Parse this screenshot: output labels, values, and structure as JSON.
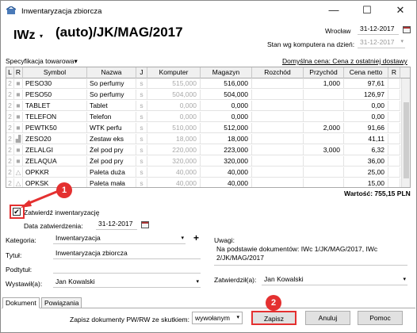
{
  "window": {
    "title": "Inwentaryzacja zbiorcza",
    "min_glyph": "—",
    "max_glyph": "☐",
    "close_glyph": "✕"
  },
  "header": {
    "doc_type": "IWz",
    "doc_caret": "▾",
    "doc_number": "(auto)/JK/MAG/2017",
    "city": "Wrocław",
    "date": "31-12-2017",
    "stock_label": "Stan wg komputera na dzień:",
    "stock_date": "31-12-2017"
  },
  "spec": {
    "label": "Specyfikacja towarowa",
    "caret": "▾",
    "price_label": "Domyślna cena: Cena z ostatniej dostawy"
  },
  "table": {
    "columns": [
      "L",
      "R",
      "Symbol",
      "Nazwa",
      "J",
      "Komputer",
      "Magazyn",
      "Rozchód",
      "Przychód",
      "Cena netto",
      "R"
    ],
    "rows": [
      {
        "l": "2",
        "r": "■",
        "symbol": "PESO30",
        "nazwa": "So perfumy",
        "j": "s",
        "komputer": "515,000",
        "magazyn": "516,000",
        "rozchod": "",
        "przychod": "1,000",
        "cena": "97,61"
      },
      {
        "l": "2",
        "r": "■",
        "symbol": "PESO50",
        "nazwa": "So perfumy",
        "j": "s",
        "komputer": "504,000",
        "magazyn": "504,000",
        "rozchod": "",
        "przychod": "",
        "cena": "126,97"
      },
      {
        "l": "2",
        "r": "■",
        "symbol": "TABLET",
        "nazwa": "Tablet",
        "j": "s",
        "komputer": "0,000",
        "magazyn": "0,000",
        "rozchod": "",
        "przychod": "",
        "cena": "0,00"
      },
      {
        "l": "2",
        "r": "■",
        "symbol": "TELEFON",
        "nazwa": "Telefon",
        "j": "s",
        "komputer": "0,000",
        "magazyn": "0,000",
        "rozchod": "",
        "przychod": "",
        "cena": "0,00"
      },
      {
        "l": "2",
        "r": "■",
        "symbol": "PEWTK50",
        "nazwa": "WTK perfu",
        "j": "s",
        "komputer": "510,000",
        "magazyn": "512,000",
        "rozchod": "",
        "przychod": "2,000",
        "cena": "91,66"
      },
      {
        "l": "2",
        "r": "▟",
        "symbol": "ZESO20",
        "nazwa": "Zestaw eks",
        "j": "s",
        "komputer": "18,000",
        "magazyn": "18,000",
        "rozchod": "",
        "przychod": "",
        "cena": "41,11"
      },
      {
        "l": "2",
        "r": "■",
        "symbol": "ZELALGI",
        "nazwa": "Żel pod pry",
        "j": "s",
        "komputer": "220,000",
        "magazyn": "223,000",
        "rozchod": "",
        "przychod": "3,000",
        "cena": "6,32"
      },
      {
        "l": "2",
        "r": "■",
        "symbol": "ZELAQUA",
        "nazwa": "Żel pod pry",
        "j": "s",
        "komputer": "320,000",
        "magazyn": "320,000",
        "rozchod": "",
        "przychod": "",
        "cena": "36,00"
      },
      {
        "l": "2",
        "r": "△",
        "symbol": "OPKKR",
        "nazwa": "Paleta duża",
        "j": "s",
        "komputer": "40,000",
        "magazyn": "40,000",
        "rozchod": "",
        "przychod": "",
        "cena": "25,00"
      },
      {
        "l": "2",
        "r": "△",
        "symbol": "OPKSK",
        "nazwa": "Paleta mała",
        "j": "s",
        "komputer": "40,000",
        "magazyn": "40,000",
        "rozchod": "",
        "przychod": "",
        "cena": "15,00"
      }
    ],
    "total": "Wartość: 755,15 PLN"
  },
  "approve": {
    "checkbox_label": "Zatwierdź inwentaryzację",
    "checked_glyph": "✔",
    "date_label": "Data zatwierdzenia:",
    "date_value": "31-12-2017"
  },
  "form": {
    "kategoria_label": "Kategoria:",
    "kategoria_value": "Inwentaryzacja",
    "plus": "+",
    "tytul_label": "Tytuł:",
    "tytul_value": "Inwentaryzacja zbiorcza",
    "podtytul_label": "Podtytuł:",
    "wystawil_label": "Wystawił(a):",
    "wystawil_value": "Jan Kowalski",
    "uwagi_label": "Uwagi:",
    "uwagi_line1": "Na podstawie dokumentów: IWc 1/JK/MAG/2017, IWc",
    "uwagi_line2": "2/JK/MAG/2017",
    "zatwierdzil_label": "Zatwierdził(a):",
    "zatwierdzil_value": "Jan Kowalski",
    "caret": "▾"
  },
  "tabs": {
    "dokument": "Dokument",
    "powiazania": "Powiązania"
  },
  "footer": {
    "save_pw_label": "Zapisz dokumenty PW/RW ze skutkiem:",
    "save_pw_value": "wywołanym",
    "caret": "▾",
    "save": "Zapisz",
    "cancel": "Anuluj",
    "help": "Pomoc"
  },
  "badges": {
    "one": "1",
    "two": "2"
  },
  "colors": {
    "accent": "#e43030"
  }
}
